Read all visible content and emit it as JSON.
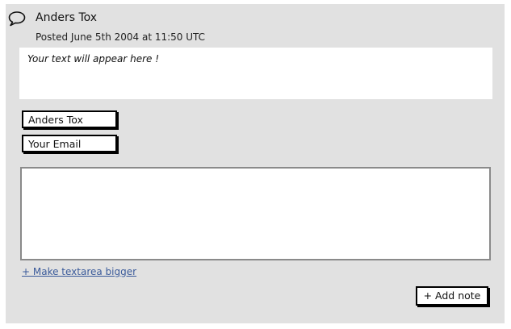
{
  "author": {
    "name": "Anders Tox",
    "icon": "speech-bubble-icon"
  },
  "posted": {
    "text": "Posted June 5th 2004 at 11:50 UTC"
  },
  "preview": {
    "text": "Your text will appear here !"
  },
  "form": {
    "name_value": "Anders Tox",
    "email_value": "Your Email",
    "textarea_value": "",
    "bigger_link": "+ Make textarea bigger",
    "add_button": "+ Add note"
  }
}
